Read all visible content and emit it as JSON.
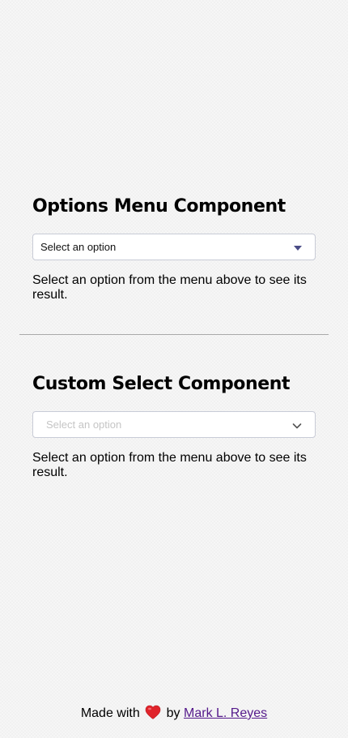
{
  "options_menu": {
    "title": "Options Menu Component",
    "select_placeholder": "Select an option",
    "result_text": "Select an option from the menu above to see its result."
  },
  "custom_select": {
    "title": "Custom Select Component",
    "select_placeholder": "Select an option",
    "result_text": "Select an option from the menu above to see its result."
  },
  "footer": {
    "made_with": "Made with",
    "by": "by",
    "author_link": "Mark L. Reyes"
  },
  "colors": {
    "caret": "#4a4c86",
    "heart": "#e0242b",
    "link": "#551a8b",
    "divider": "#a9a9a9"
  },
  "icons": {
    "options_menu_caret": "caret-down-icon",
    "custom_select_chevron": "chevron-down-icon",
    "footer_heart": "heart-icon"
  }
}
